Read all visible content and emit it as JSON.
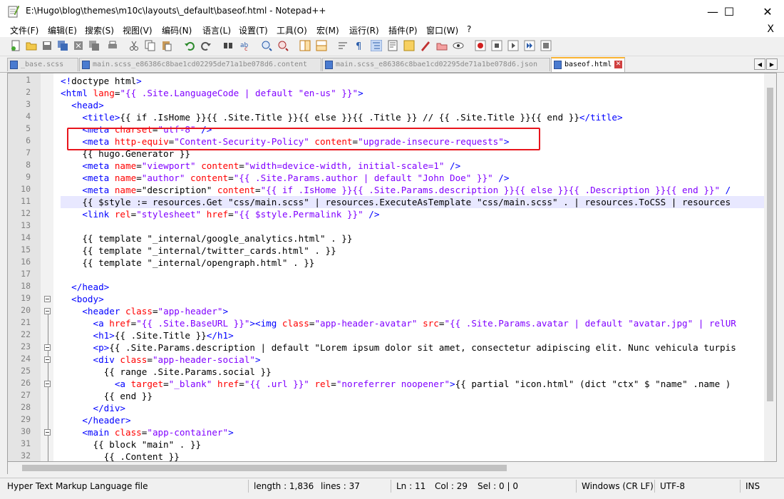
{
  "window": {
    "title": "E:\\Hugo\\blog\\themes\\m10c\\layouts\\_default\\baseof.html - Notepad++",
    "controls": [
      "—",
      "☐",
      "✕"
    ]
  },
  "menu": {
    "items": [
      "文件(F)",
      "编辑(E)",
      "搜索(S)",
      "视图(V)",
      "编码(N)",
      "语言(L)",
      "设置(T)",
      "工具(O)",
      "宏(M)",
      "运行(R)",
      "插件(P)",
      "窗口(W)",
      "?"
    ],
    "close": "X"
  },
  "tabs": [
    {
      "label": "_base.scss",
      "active": false
    },
    {
      "label": "main.scss_e86386c8bae1cd02295de71a1be078d6.content",
      "active": false
    },
    {
      "label": "main.scss_e86386c8bae1cd02295de71a1be078d6.json",
      "active": false
    },
    {
      "label": "baseof.html",
      "active": true
    }
  ],
  "editor": {
    "line_numbers": [
      "1",
      "2",
      "3",
      "4",
      "5",
      "6",
      "7",
      "8",
      "9",
      "10",
      "11",
      "12",
      "13",
      "14",
      "15",
      "16",
      "17",
      "18",
      "19",
      "20",
      "21",
      "22",
      "23",
      "24",
      "25",
      "26",
      "27",
      "28",
      "29",
      "30",
      "31",
      "32"
    ],
    "current_line": 11,
    "highlight_box_color": "#e8141c",
    "lines": [
      [
        [
          "tag",
          "<!"
        ],
        [
          "txt",
          "doctype html"
        ],
        [
          "tag",
          ">"
        ]
      ],
      [
        [
          "tag",
          "<html "
        ],
        [
          "attr",
          "lang"
        ],
        [
          "txt",
          "="
        ],
        [
          "str",
          "\"{{ .Site.LanguageCode | default \"en-us\" }}\""
        ],
        [
          "tag",
          ">"
        ]
      ],
      [
        [
          "txt",
          "  "
        ],
        [
          "tag",
          "<head>"
        ]
      ],
      [
        [
          "txt",
          "    "
        ],
        [
          "tag",
          "<title>"
        ],
        [
          "txt",
          "{{ if .IsHome }}{{ .Site.Title }}{{ else }}{{ .Title }} // {{ .Site.Title }}{{ end }}"
        ],
        [
          "tag",
          "</title>"
        ]
      ],
      [
        [
          "txt",
          "    "
        ],
        [
          "tag",
          "<meta "
        ],
        [
          "attr",
          "charset"
        ],
        [
          "txt",
          "="
        ],
        [
          "str",
          "\"utf-8\""
        ],
        [
          "tag",
          " />"
        ]
      ],
      [
        [
          "txt",
          "    "
        ],
        [
          "tag",
          "<meta "
        ],
        [
          "attr",
          "http-equiv"
        ],
        [
          "txt",
          "="
        ],
        [
          "str",
          "\"Content-Security-Policy\""
        ],
        [
          "txt",
          " "
        ],
        [
          "attr",
          "content"
        ],
        [
          "txt",
          "="
        ],
        [
          "str",
          "\"upgrade-insecure-requests\""
        ],
        [
          "tag",
          ">"
        ]
      ],
      [
        [
          "txt",
          "    {{ hugo.Generator }}"
        ]
      ],
      [
        [
          "txt",
          "    "
        ],
        [
          "tag",
          "<meta "
        ],
        [
          "attr",
          "name"
        ],
        [
          "txt",
          "="
        ],
        [
          "str",
          "\"viewport\""
        ],
        [
          "txt",
          " "
        ],
        [
          "attr",
          "content"
        ],
        [
          "txt",
          "="
        ],
        [
          "str",
          "\"width=device-width, initial-scale=1\""
        ],
        [
          "tag",
          " />"
        ]
      ],
      [
        [
          "txt",
          "    "
        ],
        [
          "tag",
          "<meta "
        ],
        [
          "attr",
          "name"
        ],
        [
          "txt",
          "="
        ],
        [
          "str",
          "\"author\""
        ],
        [
          "txt",
          " "
        ],
        [
          "attr",
          "content"
        ],
        [
          "txt",
          "="
        ],
        [
          "str",
          "\"{{ .Site.Params.author | default \"John Doe\" }}\""
        ],
        [
          "tag",
          " />"
        ]
      ],
      [
        [
          "txt",
          "    "
        ],
        [
          "tag",
          "<meta "
        ],
        [
          "attr",
          "name"
        ],
        [
          "txt",
          "=\"description\" "
        ],
        [
          "attr",
          "content"
        ],
        [
          "txt",
          "="
        ],
        [
          "str",
          "\"{{ if .IsHome }}{{ .Site.Params.description }}{{ else }}{{ .Description }}{{ end }}\""
        ],
        [
          "tag",
          " /"
        ]
      ],
      [
        [
          "txt",
          "    {{ $style := resources.Get \"css/main.scss\" | resources.ExecuteAsTemplate \"css/main.scss\" . | resources.ToCSS | resources"
        ]
      ],
      [
        [
          "txt",
          "    "
        ],
        [
          "tag",
          "<link "
        ],
        [
          "attr",
          "rel"
        ],
        [
          "txt",
          "="
        ],
        [
          "str",
          "\"stylesheet\""
        ],
        [
          "txt",
          " "
        ],
        [
          "attr",
          "href"
        ],
        [
          "txt",
          "="
        ],
        [
          "str",
          "\"{{ $style.Permalink }}\""
        ],
        [
          "tag",
          " />"
        ]
      ],
      [
        [
          "txt",
          ""
        ]
      ],
      [
        [
          "txt",
          "    {{ template \"_internal/google_analytics.html\" . }}"
        ]
      ],
      [
        [
          "txt",
          "    {{ template \"_internal/twitter_cards.html\" . }}"
        ]
      ],
      [
        [
          "txt",
          "    {{ template \"_internal/opengraph.html\" . }}"
        ]
      ],
      [
        [
          "txt",
          ""
        ]
      ],
      [
        [
          "txt",
          "  "
        ],
        [
          "tag",
          "</head>"
        ]
      ],
      [
        [
          "txt",
          "  "
        ],
        [
          "tag",
          "<body>"
        ]
      ],
      [
        [
          "txt",
          "    "
        ],
        [
          "tag",
          "<header "
        ],
        [
          "attr",
          "class"
        ],
        [
          "txt",
          "="
        ],
        [
          "str",
          "\"app-header\""
        ],
        [
          "tag",
          ">"
        ]
      ],
      [
        [
          "txt",
          "      "
        ],
        [
          "tag",
          "<a "
        ],
        [
          "attr",
          "href"
        ],
        [
          "txt",
          "="
        ],
        [
          "str",
          "\"{{ .Site.BaseURL }}\""
        ],
        [
          "tag",
          "><img "
        ],
        [
          "attr",
          "class"
        ],
        [
          "txt",
          "="
        ],
        [
          "str",
          "\"app-header-avatar\""
        ],
        [
          "txt",
          " "
        ],
        [
          "attr",
          "src"
        ],
        [
          "txt",
          "="
        ],
        [
          "str",
          "\"{{ .Site.Params.avatar | default \"avatar.jpg\" | relUR"
        ]
      ],
      [
        [
          "txt",
          "      "
        ],
        [
          "tag",
          "<h1>"
        ],
        [
          "txt",
          "{{ .Site.Title }}"
        ],
        [
          "tag",
          "</h1>"
        ]
      ],
      [
        [
          "txt",
          "      "
        ],
        [
          "tag",
          "<p>"
        ],
        [
          "txt",
          "{{ .Site.Params.description | default \"Lorem ipsum dolor sit amet, consectetur adipiscing elit. Nunc vehicula turpis"
        ]
      ],
      [
        [
          "txt",
          "      "
        ],
        [
          "tag",
          "<div "
        ],
        [
          "attr",
          "class"
        ],
        [
          "txt",
          "="
        ],
        [
          "str",
          "\"app-header-social\""
        ],
        [
          "tag",
          ">"
        ]
      ],
      [
        [
          "txt",
          "        {{ range .Site.Params.social }}"
        ]
      ],
      [
        [
          "txt",
          "          "
        ],
        [
          "tag",
          "<a "
        ],
        [
          "attr",
          "target"
        ],
        [
          "txt",
          "="
        ],
        [
          "str",
          "\"_blank\""
        ],
        [
          "txt",
          " "
        ],
        [
          "attr",
          "href"
        ],
        [
          "txt",
          "="
        ],
        [
          "str",
          "\"{{ .url }}\""
        ],
        [
          "txt",
          " "
        ],
        [
          "attr",
          "rel"
        ],
        [
          "txt",
          "="
        ],
        [
          "str",
          "\"noreferrer noopener\""
        ],
        [
          "tag",
          ">"
        ],
        [
          "txt",
          "{{ partial \"icon.html\" (dict \"ctx\" $ \"name\" .name )"
        ]
      ],
      [
        [
          "txt",
          "        {{ end }}"
        ]
      ],
      [
        [
          "txt",
          "      "
        ],
        [
          "tag",
          "</div>"
        ]
      ],
      [
        [
          "txt",
          "    "
        ],
        [
          "tag",
          "</header>"
        ]
      ],
      [
        [
          "txt",
          "    "
        ],
        [
          "tag",
          "<main "
        ],
        [
          "attr",
          "class"
        ],
        [
          "txt",
          "="
        ],
        [
          "str",
          "\"app-container\""
        ],
        [
          "tag",
          ">"
        ]
      ],
      [
        [
          "txt",
          "      {{ block \"main\" . }}"
        ]
      ],
      [
        [
          "txt",
          "        {{ .Content }}"
        ]
      ]
    ]
  },
  "status": {
    "filetype": "Hyper Text Markup Language file",
    "length": "length : 1,836",
    "lines": "lines : 37",
    "ln": "Ln : 11",
    "col": "Col : 29",
    "sel": "Sel : 0 | 0",
    "eol": "Windows (CR LF)",
    "encoding": "UTF-8",
    "mode": "INS"
  }
}
